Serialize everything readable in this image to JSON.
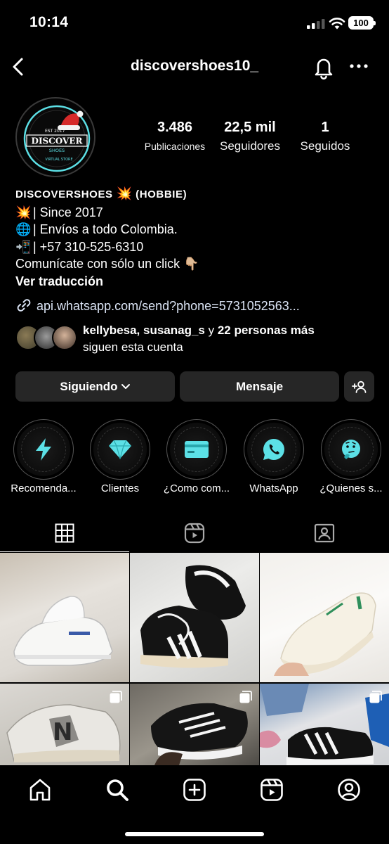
{
  "status_bar": {
    "time": "10:14",
    "battery": "100"
  },
  "header": {
    "username": "discovershoes10_"
  },
  "profile": {
    "avatar_text": {
      "year": "EST 2017",
      "brand": "DISCOVER",
      "sub": "SHOES",
      "sub2": "VIRTUAL STORE"
    },
    "stats": [
      {
        "value": "3.486",
        "label": "Publicaciones"
      },
      {
        "value": "22,5 mil",
        "label": "Seguidores"
      },
      {
        "value": "1",
        "label": "Seguidos"
      }
    ],
    "bio": {
      "name": "DISCOVERSHOES",
      "name_emoji": "💥",
      "category": "(HOBBIE)",
      "lines": [
        {
          "emoji": "💥",
          "text": " | Since 2017"
        },
        {
          "emoji": "🌐",
          "text": " | Envíos a todo Colombia."
        },
        {
          "emoji": "📲",
          "text": " | +57 310-525-6310"
        },
        {
          "emoji": "",
          "text": "Comunícate con sólo un click 👇🏼"
        }
      ],
      "translate": "Ver traducción"
    },
    "link": "api.whatsapp.com/send?phone=5731052563...",
    "followed_by": {
      "names": "kellybesa, susanag_s",
      "connector": " y ",
      "others": "22 personas más",
      "suffix": "siguen esta cuenta"
    }
  },
  "buttons": {
    "following": "Siguiendo",
    "message": "Mensaje"
  },
  "highlights": [
    {
      "label": "Recomenda...",
      "icon": "lightning-icon"
    },
    {
      "label": "Clientes",
      "icon": "diamond-icon"
    },
    {
      "label": "¿Como com...",
      "icon": "card-icon"
    },
    {
      "label": "WhatsApp",
      "icon": "whatsapp-icon"
    },
    {
      "label": "¿Quienes s...",
      "icon": "thinking-face-icon"
    }
  ],
  "colors": {
    "accent": "#5ce0e6",
    "button_bg": "#262626",
    "background": "#000000"
  }
}
